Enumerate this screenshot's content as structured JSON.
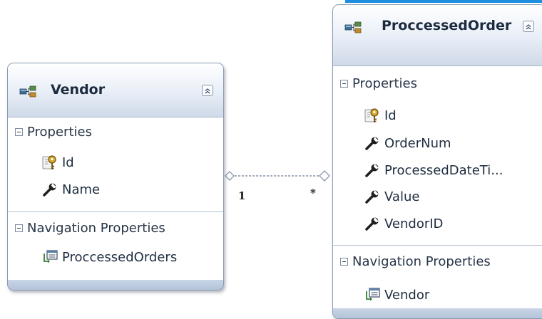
{
  "entities": {
    "vendor": {
      "title": "Vendor",
      "properties_header": "Properties",
      "properties": [
        {
          "name": "Id",
          "icon": "key-icon"
        },
        {
          "name": "Name",
          "icon": "wrench-icon"
        }
      ],
      "navigation_header": "Navigation Properties",
      "navigation": [
        {
          "name": "ProccessedOrders",
          "icon": "navigation-icon"
        }
      ]
    },
    "order": {
      "title": "ProccessedOrder",
      "properties_header": "Properties",
      "properties": [
        {
          "name": "Id",
          "icon": "key-icon"
        },
        {
          "name": "OrderNum",
          "icon": "wrench-icon"
        },
        {
          "name": "ProcessedDateTi...",
          "icon": "wrench-icon"
        },
        {
          "name": "Value",
          "icon": "wrench-icon"
        },
        {
          "name": "VendorID",
          "icon": "wrench-icon"
        }
      ],
      "navigation_header": "Navigation Properties",
      "navigation": [
        {
          "name": "Vendor",
          "icon": "navigation-icon"
        }
      ]
    }
  },
  "association": {
    "vendor_multiplicity": "1",
    "order_multiplicity": "*"
  },
  "colors": {
    "header_gradient_top": "#ffffff",
    "header_gradient_bottom": "#cfd9e8",
    "border": "#8a9bb0",
    "footer": "#b3c3d9",
    "accent": "#1e8fe0"
  }
}
